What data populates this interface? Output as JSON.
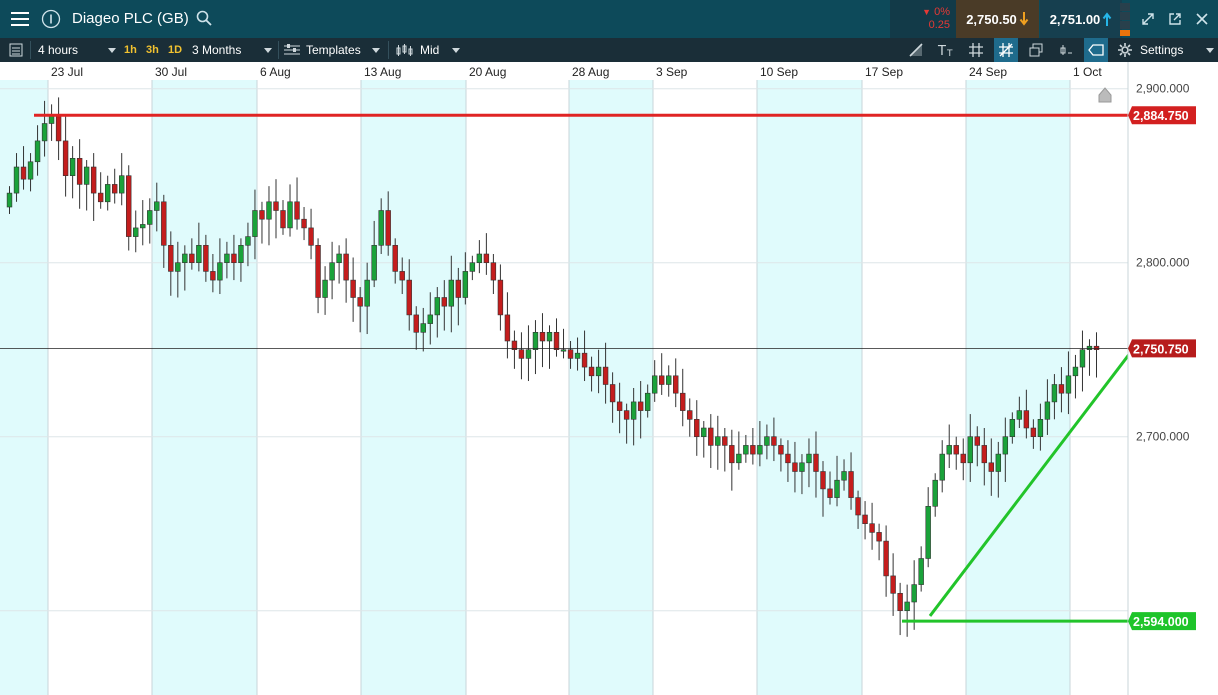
{
  "header": {
    "title": "Diageo PLC (GB)",
    "change_pct": "0%",
    "change_abs": "0.25",
    "sell_price": "2,750.50",
    "buy_price": "2,751.00"
  },
  "toolbar": {
    "interval": "4 hours",
    "quick_1h": "1h",
    "quick_3h": "3h",
    "quick_1d": "1D",
    "range": "3 Months",
    "templates": "Templates",
    "price_type": "Mid",
    "settings": "Settings"
  },
  "colors": {
    "up": "#1aa23a",
    "down": "#c41d1d",
    "resistance": "#e02424",
    "support": "#22c42a",
    "band": "#e0fbfc"
  },
  "chart_data": {
    "type": "candlestick",
    "x_labels": [
      "23 Jul",
      "30 Jul",
      "6 Aug",
      "13 Aug",
      "20 Aug",
      "28 Aug",
      "3 Sep",
      "10 Sep",
      "17 Sep",
      "24 Sep",
      "1 Oct"
    ],
    "y_ticks": [
      "2,900.000",
      "2,800.000",
      "2,700.000"
    ],
    "ylim": [
      2555,
      2905
    ],
    "last_price_label": "2,750.750",
    "last_price": 2750.75,
    "lines": [
      {
        "name": "resistance",
        "value": 2884.75,
        "label": "2,884.750",
        "from": "2018-07-20",
        "to": "right-edge"
      },
      {
        "name": "support",
        "value": 2594.0,
        "label": "2,594.000",
        "from": "17 Sep",
        "to": "right-edge"
      },
      {
        "name": "trend",
        "from_value": 2597,
        "to_value": 2748,
        "from": "20 Sep",
        "to": "right-edge"
      }
    ],
    "closes": [
      2840,
      2855,
      2848,
      2858,
      2870,
      2880,
      2885,
      2870,
      2850,
      2860,
      2845,
      2855,
      2840,
      2835,
      2845,
      2840,
      2850,
      2815,
      2820,
      2822,
      2830,
      2835,
      2810,
      2795,
      2800,
      2805,
      2800,
      2810,
      2795,
      2790,
      2800,
      2805,
      2800,
      2810,
      2815,
      2830,
      2825,
      2835,
      2830,
      2820,
      2835,
      2825,
      2820,
      2810,
      2780,
      2790,
      2800,
      2805,
      2790,
      2780,
      2775,
      2790,
      2810,
      2830,
      2810,
      2795,
      2790,
      2770,
      2760,
      2765,
      2770,
      2780,
      2775,
      2790,
      2780,
      2795,
      2800,
      2805,
      2800,
      2790,
      2770,
      2755,
      2750,
      2745,
      2750,
      2760,
      2755,
      2760,
      2750,
      2750,
      2745,
      2748,
      2740,
      2735,
      2740,
      2730,
      2720,
      2715,
      2710,
      2720,
      2715,
      2725,
      2735,
      2730,
      2735,
      2725,
      2715,
      2710,
      2700,
      2705,
      2695,
      2700,
      2695,
      2685,
      2690,
      2695,
      2690,
      2695,
      2700,
      2695,
      2690,
      2685,
      2680,
      2685,
      2690,
      2680,
      2670,
      2665,
      2675,
      2680,
      2665,
      2655,
      2650,
      2645,
      2640,
      2620,
      2610,
      2600,
      2605,
      2615,
      2630,
      2660,
      2675,
      2690,
      2695,
      2690,
      2685,
      2700,
      2695,
      2685,
      2680,
      2690,
      2700,
      2710,
      2715,
      2705,
      2700,
      2710,
      2720,
      2730,
      2725,
      2735,
      2740,
      2750,
      2752,
      2750
    ]
  }
}
